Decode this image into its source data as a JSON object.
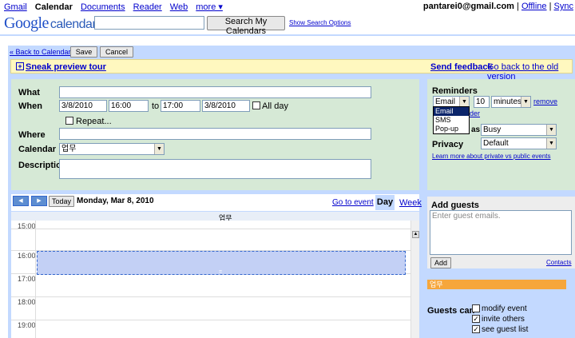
{
  "topnav": {
    "links": [
      "Gmail",
      "Calendar",
      "Documents",
      "Reader",
      "Web",
      "more ▾"
    ],
    "user_email": "pantarei0@gmail.com",
    "offline": "Offline",
    "sync": "Sync"
  },
  "logo": {
    "google": "Google",
    "calendar": "calendar"
  },
  "search": {
    "button": "Search My Calendars",
    "options": "Show Search Options",
    "value": ""
  },
  "actions": {
    "back": "« Back to Calendar",
    "save": "Save",
    "cancel": "Cancel"
  },
  "tour": {
    "label": "Sneak preview tour",
    "feedback": "Send feedback",
    "old_version": "Go back to the old version"
  },
  "form": {
    "what_label": "What",
    "what_value": "",
    "when_label": "When",
    "start_date": "3/8/2010",
    "start_time": "16:00",
    "to": "to",
    "end_time": "17:00",
    "end_date": "3/8/2010",
    "allday": "All day",
    "repeat": "Repeat...",
    "where_label": "Where",
    "where_value": "",
    "calendar_label": "Calendar",
    "calendar_value": "업무",
    "description_label": "Description",
    "description_value": ""
  },
  "side": {
    "reminders": "Reminders",
    "reminder_type": "Email",
    "reminder_qty": "10",
    "reminder_unit": "minutes",
    "remove": "remove",
    "add_partial": "der",
    "show_as_partial": "as",
    "show_as_value": "Busy",
    "privacy_label": "Privacy",
    "privacy_value": "Default",
    "privacy_link": "Learn more about private vs public events",
    "dropdown_options": [
      "Email",
      "SMS",
      "Pop-up"
    ]
  },
  "cal": {
    "today": "Today",
    "date": "Monday, Mar 8, 2010",
    "goto": "Go to event",
    "day": "Day",
    "week": "Week",
    "column_header": "업무",
    "hours": [
      "15:00",
      "16:00",
      "17:00",
      "18:00",
      "19:00"
    ]
  },
  "guests": {
    "title": "Add guests",
    "placeholder": "Enter guest emails.",
    "add": "Add",
    "contacts": "Contacts",
    "calendar_tag": "업무",
    "can_label": "Guests can",
    "perms": [
      {
        "label": "modify event",
        "checked": false
      },
      {
        "label": "invite others",
        "checked": true
      },
      {
        "label": "see guest list",
        "checked": true
      }
    ]
  }
}
